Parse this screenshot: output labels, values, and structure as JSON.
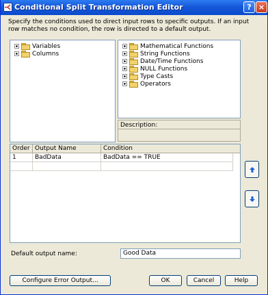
{
  "window": {
    "title": "Conditional Split Transformation Editor",
    "help_label": "?",
    "close_label": "×"
  },
  "description": "Specify the conditions used to direct input rows to specific outputs. If an input row matches no condition, the row is directed to a default output.",
  "left_tree": {
    "items": [
      {
        "label": "Variables",
        "icon": "folder-icon"
      },
      {
        "label": "Columns",
        "icon": "folder-icon"
      }
    ]
  },
  "right_tree": {
    "items": [
      {
        "label": "Mathematical Functions",
        "icon": "folder-icon"
      },
      {
        "label": "String Functions",
        "icon": "folder-icon"
      },
      {
        "label": "Date/Time Functions",
        "icon": "folder-icon"
      },
      {
        "label": "NULL Functions",
        "icon": "folder-icon"
      },
      {
        "label": "Type Casts",
        "icon": "folder-icon"
      },
      {
        "label": "Operators",
        "icon": "folder-icon"
      }
    ]
  },
  "description_panel": {
    "label": "Description:"
  },
  "grid": {
    "columns": [
      "Order",
      "Output Name",
      "Condition"
    ],
    "rows": [
      {
        "order": "1",
        "output_name": "BadData",
        "condition": "BadData == TRUE"
      }
    ]
  },
  "side_buttons": {
    "up_icon": "arrow-up-icon",
    "down_icon": "arrow-down-icon"
  },
  "default_output": {
    "label": "Default output name:",
    "value": "Good Data"
  },
  "buttons": {
    "configure": "Configure Error Output...",
    "ok": "OK",
    "cancel": "Cancel",
    "help": "Help"
  },
  "colors": {
    "titlebar": "#0A4BCC",
    "dialog_bg": "#ECE9D8",
    "border": "#7F9DB9",
    "arrow": "#1F5FCF"
  }
}
